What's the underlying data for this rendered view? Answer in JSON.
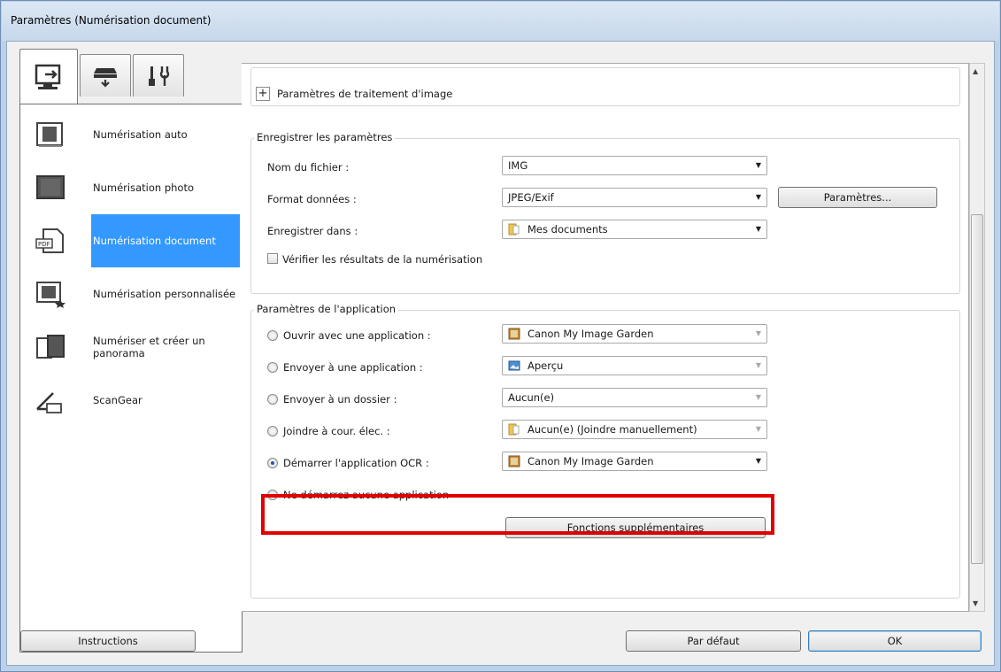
{
  "window": {
    "title": "Paramètres (Numérisation document)"
  },
  "tabs": [
    {
      "name": "scan-from-computer",
      "icon": "computer-scan-icon"
    },
    {
      "name": "scan-from-panel",
      "icon": "scanner-icon"
    },
    {
      "name": "general-settings",
      "icon": "tools-icon"
    }
  ],
  "nav": [
    {
      "label": "Numérisation auto",
      "icon": "auto-scan-icon"
    },
    {
      "label": "Numérisation photo",
      "icon": "photo-scan-icon"
    },
    {
      "label": "Numérisation document",
      "icon": "document-scan-icon",
      "selected": true
    },
    {
      "label": "Numérisation personnalisée",
      "icon": "custom-scan-icon"
    },
    {
      "label_line1": "Numériser et créer un",
      "label_line2": "panorama",
      "icon": "panorama-icon"
    },
    {
      "label": "ScanGear",
      "icon": "scangear-icon"
    }
  ],
  "image_processing": {
    "label": "Paramètres de traitement d'image",
    "expand_symbol": "+"
  },
  "save_settings": {
    "title": "Enregistrer les paramètres",
    "file_name_label": "Nom du fichier :",
    "file_name_value": "IMG",
    "data_format_label": "Format données :",
    "data_format_value": "JPEG/Exif",
    "settings_button": "Paramètres...",
    "save_in_label": "Enregistrer dans :",
    "save_in_value": "Mes documents",
    "check_results_label": "Vérifier les résultats de la numérisation"
  },
  "app_settings": {
    "title": "Paramètres de l'application",
    "options": [
      {
        "label": "Ouvrir avec une application :",
        "value": "Canon My Image Garden",
        "checked": false
      },
      {
        "label": "Envoyer à une application :",
        "value": "Aperçu",
        "checked": false
      },
      {
        "label": "Envoyer à un dossier :",
        "value": "Aucun(e)",
        "checked": false
      },
      {
        "label": "Joindre à cour. élec. :",
        "value": "Aucun(e) (Joindre manuellement)",
        "checked": false
      },
      {
        "label": "Démarrer l'application OCR :",
        "value": "Canon My Image Garden",
        "checked": true
      },
      {
        "label": "Ne démarrez aucune application",
        "checked": false
      }
    ],
    "extra_button": "Fonctions supplémentaires"
  },
  "footer": {
    "instructions": "Instructions",
    "defaults": "Par défaut",
    "ok": "OK"
  },
  "colors": {
    "selection": "#3399ff",
    "highlight": "#e00000"
  }
}
